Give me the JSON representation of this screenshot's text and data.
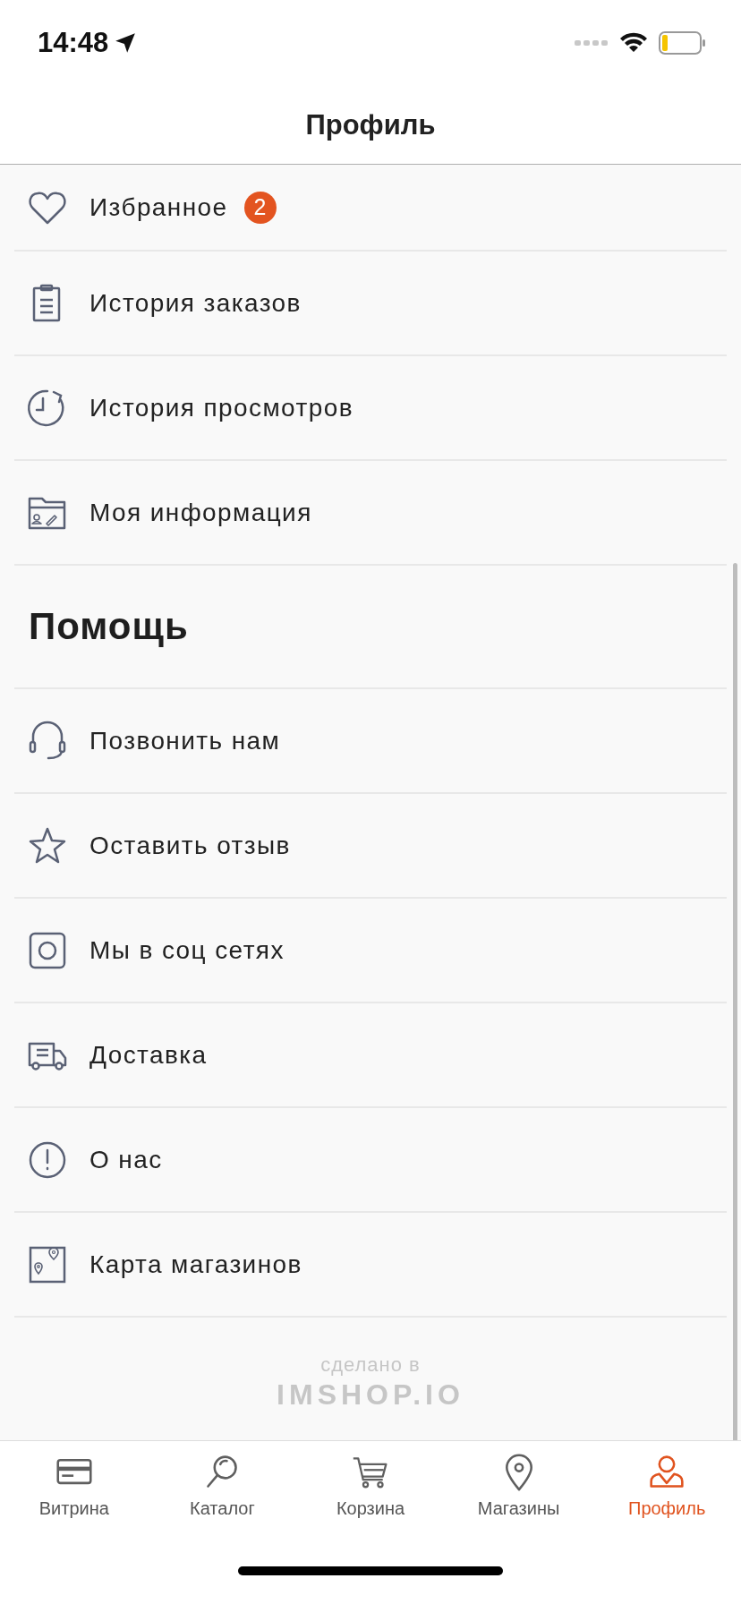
{
  "status_bar": {
    "time": "14:48"
  },
  "header": {
    "title": "Профиль"
  },
  "account_items": [
    {
      "label": "Избранное",
      "badge": "2"
    },
    {
      "label": "История заказов"
    },
    {
      "label": "История просмотров"
    },
    {
      "label": "Моя информация"
    }
  ],
  "help_section": {
    "title": "Помощь",
    "items": [
      {
        "label": "Позвонить нам"
      },
      {
        "label": "Оставить отзыв"
      },
      {
        "label": "Мы в соц сетях"
      },
      {
        "label": "Доставка"
      },
      {
        "label": "О нас"
      },
      {
        "label": "Карта магазинов"
      }
    ]
  },
  "footer": {
    "caption": "сделано в",
    "brand": "IMSHOP.IO"
  },
  "tabs": [
    {
      "label": "Витрина",
      "selected": false
    },
    {
      "label": "Каталог",
      "selected": false
    },
    {
      "label": "Корзина",
      "selected": false
    },
    {
      "label": "Магазины",
      "selected": false
    },
    {
      "label": "Профиль",
      "selected": true
    }
  ]
}
